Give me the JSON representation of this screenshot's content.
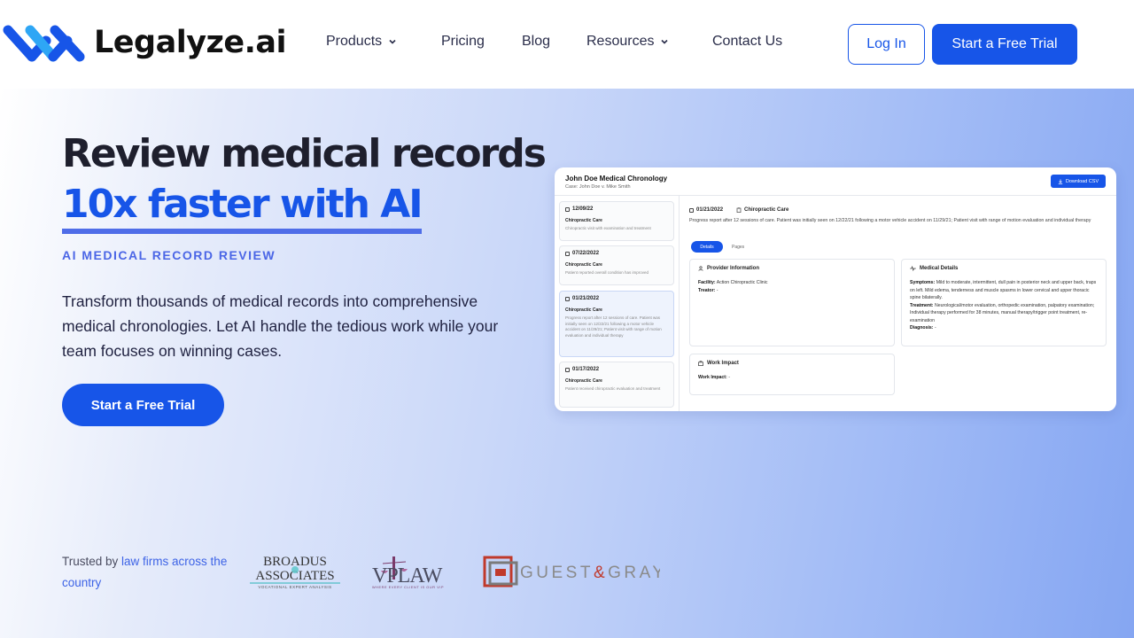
{
  "brand": {
    "name": "Legalyze.ai",
    "accent": "#1755e8",
    "accent_light": "#2ea6f5"
  },
  "nav": {
    "items": [
      {
        "label": "Products",
        "has_dropdown": true
      },
      {
        "label": "Pricing",
        "has_dropdown": false
      },
      {
        "label": "Blog",
        "has_dropdown": false
      },
      {
        "label": "Resources",
        "has_dropdown": true
      },
      {
        "label": "Contact Us",
        "has_dropdown": false
      }
    ],
    "login_label": "Log In",
    "trial_label": "Start a Free Trial"
  },
  "hero": {
    "headline": "Review medical records",
    "headline_accent": "10x faster with AI",
    "eyebrow": "AI MEDICAL RECORD REVIEW",
    "paragraph": "Transform thousands of medical records into comprehensive medical chronologies. Let AI handle the tedious work while your team focuses on winning cases.",
    "cta_label": "Start a Free Trial"
  },
  "app_preview": {
    "title": "John Doe Medical Chronology",
    "case": "Case: John Doe v. Mike Smith",
    "download_label": "Download CSV",
    "records": [
      {
        "date": "12/09/22",
        "type": "Chiropractic Care",
        "desc": "Chiropractic visit with examination and treatment"
      },
      {
        "date": "07/22/2022",
        "type": "Chiropractic Care",
        "desc": "Patient reported overall condition has improved"
      },
      {
        "date": "01/21/2022",
        "type": "Chiropractic Care",
        "desc": "Progress report after 12 sessions of care. Patient was initially seen on 12/22/21 following a motor vehicle accident on 11/29/21; Patient visit with range of motion evaluation and individual therapy"
      },
      {
        "date": "01/17/2022",
        "type": "Chiropractic Care",
        "desc": "Patient received chiropractic evaluation and treatment"
      }
    ],
    "selected": {
      "date": "01/21/2022",
      "type": "Chiropractic Care",
      "desc": "Progress report after 12 sessions of care. Patient was initially seen on 12/22/21 following a motor vehicle accident on 11/29/21; Patient visit with range of motion evaluation and individual therapy"
    },
    "tabs": {
      "details": "Details",
      "pages": "Pages"
    },
    "provider": {
      "title": "Provider Information",
      "facility_label": "Facility:",
      "facility": "Action Chiropractic Clinic",
      "treator_label": "Treator:",
      "treator": "-"
    },
    "medical": {
      "title": "Medical Details",
      "symptoms_label": "Symptoms:",
      "symptoms": "Mild to moderate, intermittent, dull pain in posterior neck and upper back, traps on left. Mild edema, tenderness and muscle spasms in lower cervical and upper thoracic spine bilaterally.",
      "treatment_label": "Treatment:",
      "treatment": "Neurological/motor evaluation, orthopedic examination, palpatory examination; Individual therapy performed for 38 minutes, manual therapy/trigger point treatment, re-examination",
      "diagnosis_label": "Diagnosis:",
      "diagnosis": "-"
    },
    "work": {
      "title": "Work Impact",
      "impact_label": "Work Impact:",
      "impact": "-"
    }
  },
  "trusted": {
    "prefix": "Trusted by",
    "link": "law firms across the country",
    "logos": [
      {
        "line1": "BROADUS",
        "line2": "ASSOCIATES",
        "tagline": "VOCATIONAL EXPERT ANALYSIS"
      },
      {
        "text": "VPLAW",
        "tagline": "WHERE EVERY CLIENT IS OUR VIP"
      },
      {
        "text_a": "GUEST",
        "amp": "&",
        "text_b": "GRAY"
      }
    ]
  }
}
